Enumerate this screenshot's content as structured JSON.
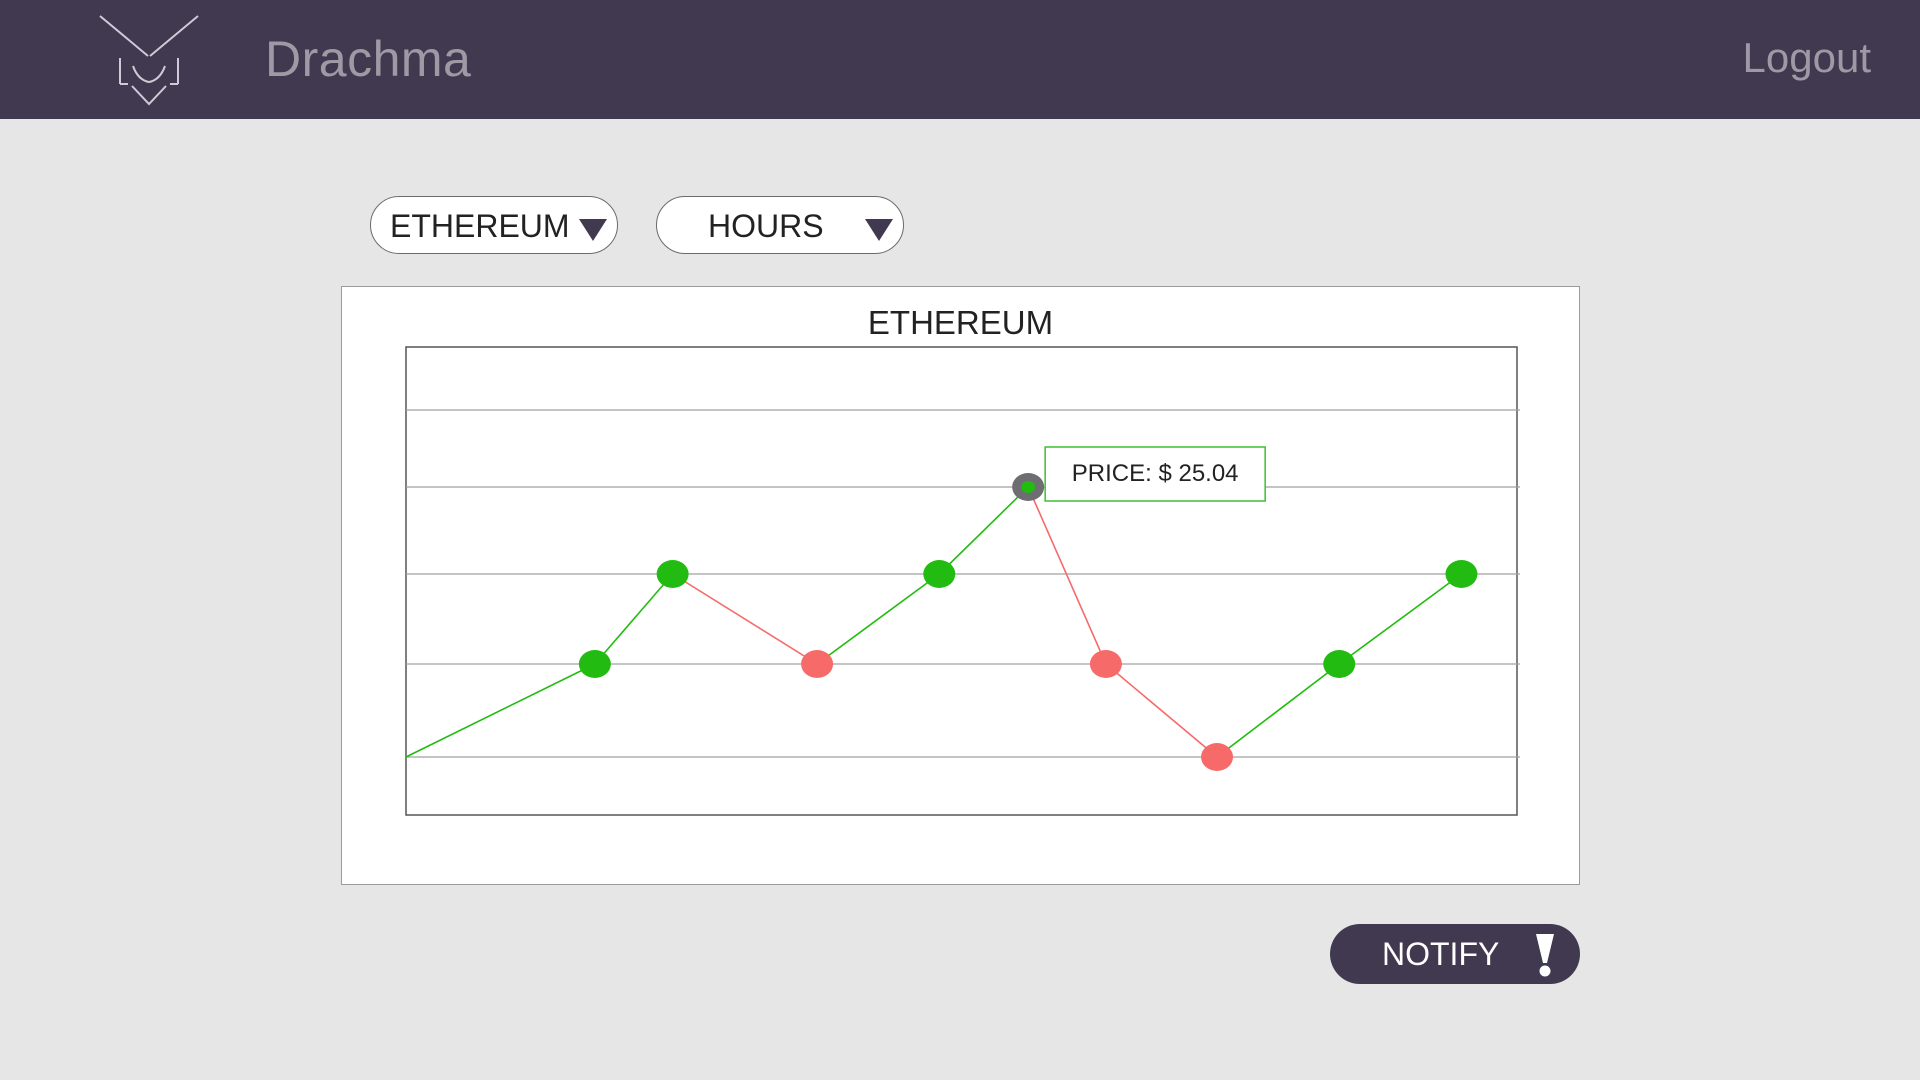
{
  "app": {
    "brand": "Drachma",
    "logout_label": "Logout"
  },
  "controls": {
    "coin_select": "ETHEREUM",
    "period_select": "HOURS"
  },
  "colors": {
    "header": "#40394f",
    "up": "#22bb11",
    "down": "#f76a6a",
    "selected_marker": "#6d6d72",
    "tooltip_border": "#3fbf2f"
  },
  "chart_data": {
    "type": "line",
    "title": "ETHEREUM",
    "xlabel": "",
    "ylabel": "",
    "x": [
      0,
      1,
      2,
      3,
      4,
      5,
      6,
      7,
      8,
      9
    ],
    "ylim": [
      0,
      5
    ],
    "grid": true,
    "series": [
      {
        "values": [
          1,
          2,
          3,
          2,
          3,
          4,
          2,
          1,
          2,
          3
        ],
        "markers": [
          false,
          true,
          true,
          true,
          true,
          true,
          true,
          true,
          true,
          true
        ],
        "point_x": [
          0,
          1.7,
          2.4,
          3.7,
          4.8,
          5.6,
          6.3,
          7.3,
          8.4,
          9.5
        ]
      }
    ],
    "tooltip": {
      "point_index": 5,
      "label": "PRICE: $ 25.04"
    }
  },
  "notify": {
    "label": "NOTIFY",
    "icon": "exclamation-icon"
  },
  "logo": {
    "icon": "owl-logo-icon"
  }
}
